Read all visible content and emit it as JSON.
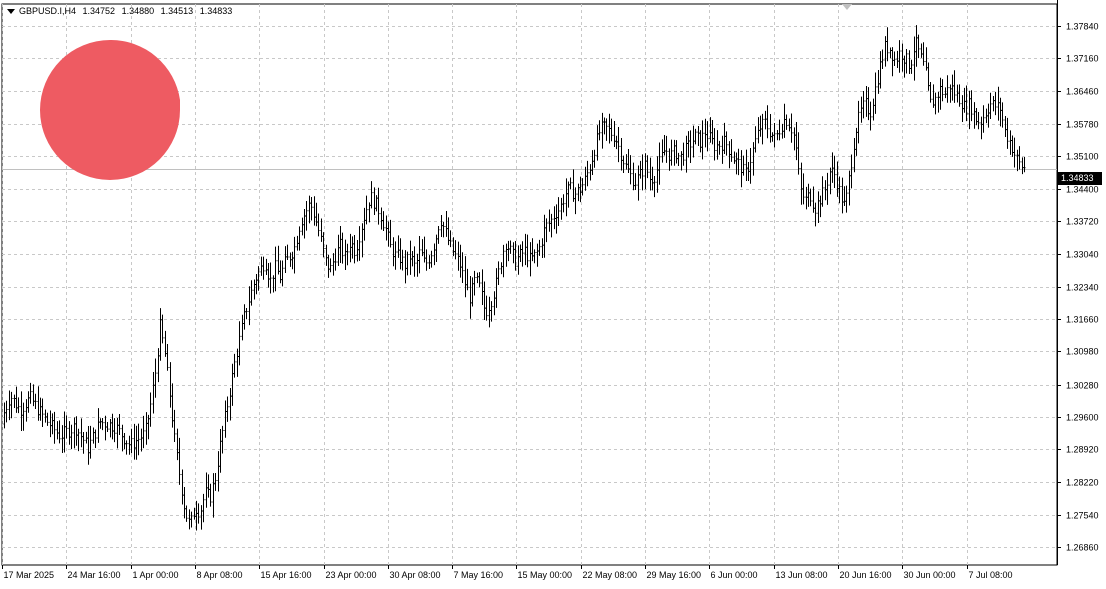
{
  "header": {
    "symbol": "GBPUSD.I,H4",
    "open": "1.34752",
    "high": "1.34880",
    "low": "1.34513",
    "close": "1.34833"
  },
  "current_price_label": "1.34833",
  "logo": {
    "name": "brand-logo",
    "color": "#ee5b62"
  },
  "colors": {
    "background": "#ffffff",
    "grid": "#c8c8c8",
    "bars": "#000000",
    "price_line": "#c0c0c0"
  },
  "chart_data": {
    "type": "ohlc",
    "title": "",
    "ylim": [
      1.2648,
      1.383
    ],
    "y_ticks": [
      "1.37840",
      "1.37160",
      "1.36460",
      "1.35780",
      "1.35100",
      "1.34400",
      "1.33720",
      "1.33040",
      "1.32340",
      "1.31660",
      "1.30980",
      "1.30280",
      "1.29600",
      "1.28920",
      "1.28220",
      "1.27540",
      "1.26860"
    ],
    "x_ticks": [
      "17 Mar 2025",
      "24 Mar 16:00",
      "1 Apr 00:00",
      "8 Apr 08:00",
      "15 Apr 16:00",
      "23 Apr 00:00",
      "30 Apr 08:00",
      "7 May 16:00",
      "15 May 00:00",
      "22 May 08:00",
      "29 May 16:00",
      "6 Jun 00:00",
      "13 Jun 08:00",
      "20 Jun 16:00",
      "30 Jun 00:00",
      "7 Jul 08:00"
    ],
    "grid": true,
    "last_price": 1.34833,
    "close_path": [
      [
        0,
        1.2945
      ],
      [
        10,
        1.3005
      ],
      [
        20,
        1.2975
      ],
      [
        30,
        1.3
      ],
      [
        45,
        1.2955
      ],
      [
        60,
        1.292
      ],
      [
        75,
        1.294
      ],
      [
        88,
        1.2895
      ],
      [
        100,
        1.295
      ],
      [
        115,
        1.294
      ],
      [
        130,
        1.29
      ],
      [
        145,
        1.2925
      ],
      [
        150,
        1.298
      ],
      [
        155,
        1.305
      ],
      [
        160,
        1.315
      ],
      [
        165,
        1.309
      ],
      [
        170,
        1.3
      ],
      [
        175,
        1.29
      ],
      [
        180,
        1.283
      ],
      [
        185,
        1.276
      ],
      [
        190,
        1.273
      ],
      [
        195,
        1.277
      ],
      [
        200,
        1.276
      ],
      [
        205,
        1.28
      ],
      [
        210,
        1.279
      ],
      [
        215,
        1.283
      ],
      [
        220,
        1.29
      ],
      [
        225,
        1.296
      ],
      [
        230,
        1.302
      ],
      [
        235,
        1.308
      ],
      [
        240,
        1.313
      ],
      [
        245,
        1.318
      ],
      [
        250,
        1.3215
      ],
      [
        255,
        1.325
      ],
      [
        260,
        1.327
      ],
      [
        265,
        1.329
      ],
      [
        270,
        1.3245
      ],
      [
        275,
        1.3275
      ],
      [
        280,
        1.3255
      ],
      [
        285,
        1.3285
      ],
      [
        290,
        1.33
      ],
      [
        295,
        1.332
      ],
      [
        300,
        1.337
      ],
      [
        305,
        1.339
      ],
      [
        310,
        1.341
      ],
      [
        315,
        1.338
      ],
      [
        320,
        1.334
      ],
      [
        325,
        1.329
      ],
      [
        330,
        1.327
      ],
      [
        335,
        1.33
      ],
      [
        340,
        1.332
      ],
      [
        345,
        1.3295
      ],
      [
        350,
        1.333
      ],
      [
        355,
        1.331
      ],
      [
        360,
        1.335
      ],
      [
        365,
        1.339
      ],
      [
        370,
        1.3425
      ],
      [
        375,
        1.341
      ],
      [
        380,
        1.339
      ],
      [
        385,
        1.336
      ],
      [
        390,
        1.332
      ],
      [
        395,
        1.33
      ],
      [
        400,
        1.3295
      ],
      [
        405,
        1.328
      ],
      [
        410,
        1.33
      ],
      [
        415,
        1.3275
      ],
      [
        420,
        1.331
      ],
      [
        425,
        1.328
      ],
      [
        430,
        1.33
      ],
      [
        435,
        1.333
      ],
      [
        440,
        1.338
      ],
      [
        445,
        1.335
      ],
      [
        450,
        1.332
      ],
      [
        455,
        1.33
      ],
      [
        460,
        1.328
      ],
      [
        465,
        1.324
      ],
      [
        470,
        1.321
      ],
      [
        475,
        1.325
      ],
      [
        480,
        1.323
      ],
      [
        485,
        1.318
      ],
      [
        490,
        1.32
      ],
      [
        495,
        1.323
      ],
      [
        500,
        1.328
      ],
      [
        505,
        1.333
      ],
      [
        510,
        1.331
      ],
      [
        515,
        1.329
      ],
      [
        520,
        1.33
      ],
      [
        525,
        1.331
      ],
      [
        530,
        1.329
      ],
      [
        535,
        1.33
      ],
      [
        540,
        1.332
      ],
      [
        545,
        1.336
      ],
      [
        550,
        1.337
      ],
      [
        555,
        1.339
      ],
      [
        560,
        1.34
      ],
      [
        565,
        1.343
      ],
      [
        570,
        1.344
      ],
      [
        575,
        1.343
      ],
      [
        580,
        1.344
      ],
      [
        585,
        1.346
      ],
      [
        590,
        1.349
      ],
      [
        595,
        1.353
      ],
      [
        600,
        1.3565
      ],
      [
        605,
        1.357
      ],
      [
        610,
        1.356
      ],
      [
        615,
        1.355
      ],
      [
        620,
        1.352
      ],
      [
        625,
        1.349
      ],
      [
        630,
        1.347
      ],
      [
        635,
        1.3455
      ],
      [
        640,
        1.347
      ],
      [
        645,
        1.349
      ],
      [
        650,
        1.346
      ],
      [
        655,
        1.347
      ],
      [
        660,
        1.35
      ],
      [
        665,
        1.3525
      ],
      [
        670,
        1.351
      ],
      [
        675,
        1.352
      ],
      [
        680,
        1.3505
      ],
      [
        685,
        1.352
      ],
      [
        690,
        1.3535
      ],
      [
        695,
        1.355
      ],
      [
        700,
        1.354
      ],
      [
        705,
        1.356
      ],
      [
        710,
        1.3545
      ],
      [
        715,
        1.353
      ],
      [
        720,
        1.3535
      ],
      [
        725,
        1.354
      ],
      [
        730,
        1.352
      ],
      [
        735,
        1.35
      ],
      [
        740,
        1.349
      ],
      [
        745,
        1.347
      ],
      [
        750,
        1.35
      ],
      [
        755,
        1.354
      ],
      [
        760,
        1.357
      ],
      [
        765,
        1.358
      ],
      [
        770,
        1.356
      ],
      [
        775,
        1.3545
      ],
      [
        780,
        1.357
      ],
      [
        785,
        1.359
      ],
      [
        790,
        1.3575
      ],
      [
        795,
        1.3545
      ],
      [
        800,
        1.344
      ],
      [
        805,
        1.3415
      ],
      [
        810,
        1.343
      ],
      [
        815,
        1.34
      ],
      [
        820,
        1.342
      ],
      [
        825,
        1.344
      ],
      [
        830,
        1.348
      ],
      [
        835,
        1.347
      ],
      [
        840,
        1.343
      ],
      [
        845,
        1.34
      ],
      [
        850,
        1.348
      ],
      [
        855,
        1.356
      ],
      [
        860,
        1.36
      ],
      [
        865,
        1.362
      ],
      [
        870,
        1.36
      ],
      [
        875,
        1.365
      ],
      [
        880,
        1.37
      ],
      [
        885,
        1.374
      ],
      [
        890,
        1.3735
      ],
      [
        895,
        1.371
      ],
      [
        900,
        1.373
      ],
      [
        905,
        1.3715
      ],
      [
        910,
        1.37
      ],
      [
        915,
        1.375
      ],
      [
        920,
        1.372
      ],
      [
        925,
        1.369
      ],
      [
        930,
        1.362
      ],
      [
        935,
        1.363
      ],
      [
        940,
        1.365
      ],
      [
        945,
        1.364
      ],
      [
        950,
        1.366
      ],
      [
        955,
        1.364
      ],
      [
        960,
        1.363
      ],
      [
        965,
        1.361
      ],
      [
        970,
        1.362
      ],
      [
        975,
        1.359
      ],
      [
        980,
        1.358
      ],
      [
        985,
        1.36
      ],
      [
        990,
        1.362
      ],
      [
        995,
        1.3615
      ],
      [
        1000,
        1.361
      ],
      [
        1005,
        1.356
      ],
      [
        1010,
        1.354
      ],
      [
        1015,
        1.351
      ],
      [
        1020,
        1.349
      ],
      [
        1025,
        1.3483
      ]
    ]
  }
}
